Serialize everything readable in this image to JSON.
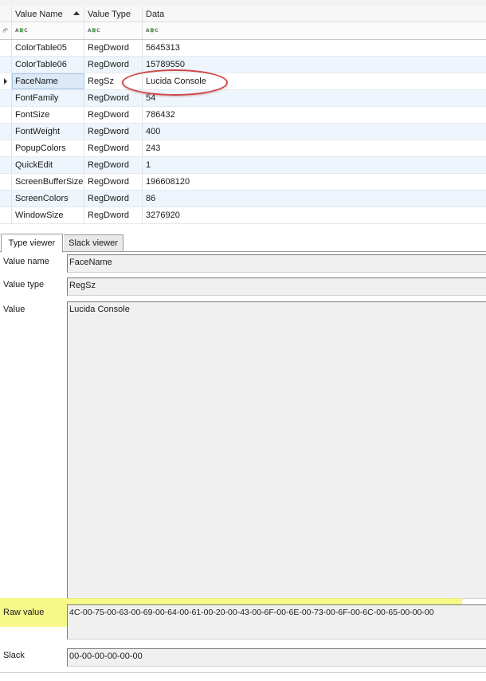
{
  "columns": {
    "name": "Value Name",
    "type": "Value Type",
    "data": "Data"
  },
  "filter": {
    "icon": "abc-filter-icon",
    "pin": "pin-icon"
  },
  "rows": [
    {
      "name": "ColorTable05",
      "type": "RegDword",
      "data": "5645313"
    },
    {
      "name": "ColorTable06",
      "type": "RegDword",
      "data": "15789550"
    },
    {
      "name": "FaceName",
      "type": "RegSz",
      "data": "Lucida Console",
      "selected": true
    },
    {
      "name": "FontFamily",
      "type": "RegDword",
      "data": "54"
    },
    {
      "name": "FontSize",
      "type": "RegDword",
      "data": "786432"
    },
    {
      "name": "FontWeight",
      "type": "RegDword",
      "data": "400"
    },
    {
      "name": "PopupColors",
      "type": "RegDword",
      "data": "243"
    },
    {
      "name": "QuickEdit",
      "type": "RegDword",
      "data": "1"
    },
    {
      "name": "ScreenBufferSize",
      "type": "RegDword",
      "data": "196608120"
    },
    {
      "name": "ScreenColors",
      "type": "RegDword",
      "data": "86"
    },
    {
      "name": "WindowSize",
      "type": "RegDword",
      "data": "3276920"
    }
  ],
  "tabs": {
    "type_viewer": "Type viewer",
    "slack_viewer": "Slack viewer"
  },
  "details": {
    "value_name_label": "Value name",
    "value_name": "FaceName",
    "value_type_label": "Value type",
    "value_type": "RegSz",
    "value_label": "Value",
    "value": "Lucida Console",
    "raw_label": "Raw value",
    "raw": "4C-00-75-00-63-00-69-00-64-00-61-00-20-00-43-00-6F-00-6E-00-73-00-6F-00-6C-00-65-00-00-00",
    "slack_label": "Slack",
    "slack": "00-00-00-00-00-00"
  },
  "colors": {
    "alt_row": "#eef5fc",
    "selected_cell": "#dbe9f8",
    "annotation_ellipse": "#d04848",
    "annotation_highlight": "#f3f55a"
  }
}
